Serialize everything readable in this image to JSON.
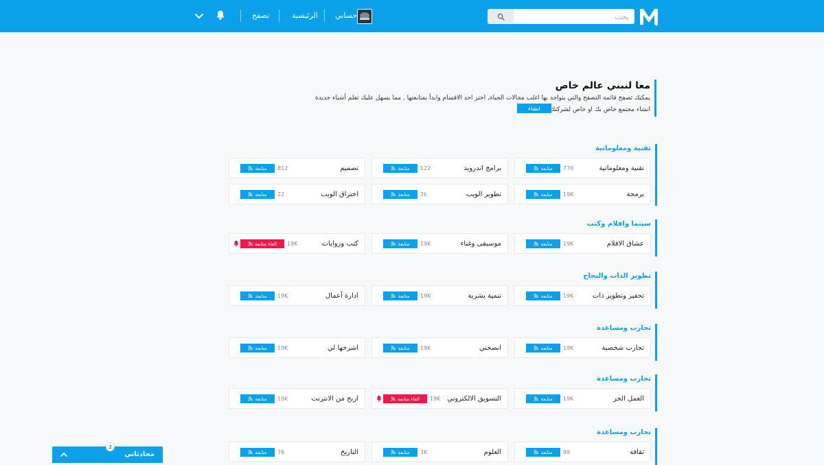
{
  "header": {
    "search_placeholder": "بحث",
    "account_label": "حسابي",
    "home_label": "الرئيسية",
    "browse_label": "تصفح"
  },
  "intro": {
    "title": "معا لنبني عالم خاص",
    "description": "يمكنك تصفح قائمة التصفح والتي يتواجد بها اغلب مجالات الحياة, اختر احد الاقسام وابدأ بمتابعتها , مما يسهل عليك تعلم أشياء جديدة",
    "create_text": "انشاء مجتمع خاص بك او خاص لشركتك",
    "create_button": "انشاء"
  },
  "sections": [
    {
      "title": "تقنية ومعلوماتية",
      "cards": [
        {
          "name": "تقنية ومعلوماتية",
          "count": "776",
          "button": "متابعة",
          "following": false
        },
        {
          "name": "برامج اندرويد",
          "count": "122",
          "button": "متابعة",
          "following": false
        },
        {
          "name": "تصميم",
          "count": "812",
          "button": "متابعة",
          "following": false
        },
        {
          "name": "برمجة",
          "count": "19K",
          "button": "متابعة",
          "following": false
        },
        {
          "name": "تطوير الويب",
          "count": "2k",
          "button": "متابعة",
          "following": false
        },
        {
          "name": "اختراق الويب",
          "count": "22",
          "button": "متابعة",
          "following": false
        }
      ]
    },
    {
      "title": "سينما وافلام وكتب",
      "cards": [
        {
          "name": "عشاق الافلام",
          "count": "19K",
          "button": "متابعة",
          "following": false
        },
        {
          "name": "موسيقى وغناء",
          "count": "19K",
          "button": "متابعة",
          "following": false
        },
        {
          "name": "كتب وروايات",
          "count": "19K",
          "button": "الغاء متابعة",
          "following": true
        }
      ]
    },
    {
      "title": "تطوير الذات والنجاح",
      "cards": [
        {
          "name": "تحفيز وتطوير ذات",
          "count": "19K",
          "button": "متابعة",
          "following": false
        },
        {
          "name": "تنمية بشرية",
          "count": "19K",
          "button": "متابعة",
          "following": false
        },
        {
          "name": "ادارة أعمال",
          "count": "19K",
          "button": "متابعة",
          "following": false
        }
      ]
    },
    {
      "title": "تجارب ومساعدة",
      "cards": [
        {
          "name": "تجارب شخصية",
          "count": "19K",
          "button": "متابعة",
          "following": false
        },
        {
          "name": "انصحني",
          "count": "19K",
          "button": "متابعة",
          "following": false
        },
        {
          "name": "اشرحها لي",
          "count": "19K",
          "button": "متابعة",
          "following": false
        }
      ]
    },
    {
      "title": "تجارب ومساعدة",
      "cards": [
        {
          "name": "العمل الحر",
          "count": "19K",
          "button": "متابعة",
          "following": false
        },
        {
          "name": "التسويق الالكتروني",
          "count": "19K",
          "button": "الغاء متابعة",
          "following": true
        },
        {
          "name": "اربح من الانترنت",
          "count": "19K",
          "button": "متابعة",
          "following": false
        }
      ]
    },
    {
      "title": "تجارب ومساعدة",
      "cards": [
        {
          "name": "ثقافة",
          "count": "99",
          "button": "متابعة",
          "following": false
        },
        {
          "name": "العلوم",
          "count": "3K",
          "button": "متابعة",
          "following": false
        },
        {
          "name": "التاريخ",
          "count": "76",
          "button": "متابعة",
          "following": false
        }
      ]
    }
  ],
  "chat": {
    "label": "محادثاتي",
    "badge": "2"
  },
  "colors": {
    "primary": "#0aa0ea",
    "unfollow": "#f0174b",
    "background": "#f7f8fa"
  },
  "icons": {
    "logo": "m-logo-icon",
    "search": "search-icon",
    "notifications": "bell-icon",
    "menu": "chevron-down-icon",
    "follow": "feed-icon",
    "chat_toggle": "chevron-up-icon"
  }
}
